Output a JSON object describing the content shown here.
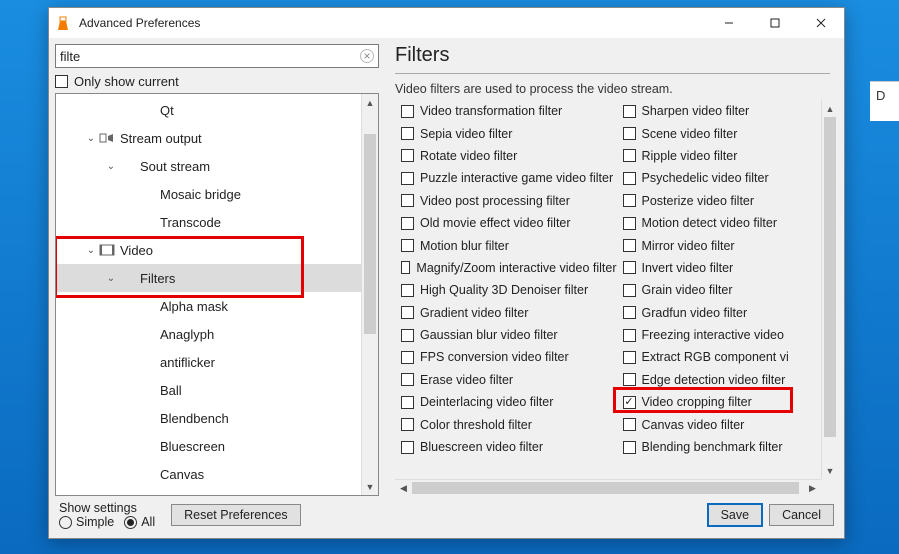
{
  "window": {
    "title": "Advanced Preferences"
  },
  "search": {
    "value": "filte"
  },
  "only_current_label": "Only show current",
  "tree": {
    "items": [
      {
        "label": "Qt",
        "indent": 3,
        "chev": "",
        "icon": ""
      },
      {
        "label": "Stream output",
        "indent": 1,
        "chev": "⌄",
        "icon": "stream"
      },
      {
        "label": "Sout stream",
        "indent": 2,
        "chev": "⌄",
        "icon": ""
      },
      {
        "label": "Mosaic bridge",
        "indent": 3,
        "chev": "",
        "icon": ""
      },
      {
        "label": "Transcode",
        "indent": 3,
        "chev": "",
        "icon": ""
      },
      {
        "label": "Video",
        "indent": 1,
        "chev": "⌄",
        "icon": "video"
      },
      {
        "label": "Filters",
        "indent": 2,
        "chev": "⌄",
        "icon": "",
        "selected": true
      },
      {
        "label": "Alpha mask",
        "indent": 3,
        "chev": "",
        "icon": ""
      },
      {
        "label": "Anaglyph",
        "indent": 3,
        "chev": "",
        "icon": ""
      },
      {
        "label": "antiflicker",
        "indent": 3,
        "chev": "",
        "icon": ""
      },
      {
        "label": "Ball",
        "indent": 3,
        "chev": "",
        "icon": ""
      },
      {
        "label": "Blendbench",
        "indent": 3,
        "chev": "",
        "icon": ""
      },
      {
        "label": "Bluescreen",
        "indent": 3,
        "chev": "",
        "icon": ""
      },
      {
        "label": "Canvas",
        "indent": 3,
        "chev": "",
        "icon": ""
      }
    ]
  },
  "panel": {
    "title": "Filters",
    "desc": "Video filters are used to process the video stream.",
    "left": [
      "Video transformation filter",
      "Sepia video filter",
      "Rotate video filter",
      "Puzzle interactive game video filter",
      "Video post processing filter",
      "Old movie effect video filter",
      "Motion blur filter",
      "Magnify/Zoom interactive video filter",
      "High Quality 3D Denoiser filter",
      "Gradient video filter",
      "Gaussian blur video filter",
      "FPS conversion video filter",
      "Erase video filter",
      "Deinterlacing video filter",
      "Color threshold filter",
      "Bluescreen video filter"
    ],
    "right": [
      {
        "label": "Sharpen video filter",
        "checked": false
      },
      {
        "label": "Scene video filter",
        "checked": false
      },
      {
        "label": "Ripple video filter",
        "checked": false
      },
      {
        "label": "Psychedelic video filter",
        "checked": false
      },
      {
        "label": "Posterize video filter",
        "checked": false
      },
      {
        "label": "Motion detect video filter",
        "checked": false
      },
      {
        "label": "Mirror video filter",
        "checked": false
      },
      {
        "label": "Invert video filter",
        "checked": false
      },
      {
        "label": "Grain video filter",
        "checked": false
      },
      {
        "label": "Gradfun video filter",
        "checked": false
      },
      {
        "label": "Freezing interactive video",
        "checked": false
      },
      {
        "label": "Extract RGB component vi",
        "checked": false
      },
      {
        "label": "Edge detection video filter",
        "checked": false
      },
      {
        "label": "Video cropping filter",
        "checked": true
      },
      {
        "label": "Canvas video filter",
        "checked": false
      },
      {
        "label": "Blending benchmark filter",
        "checked": false
      }
    ]
  },
  "footer": {
    "show_settings": "Show settings",
    "simple": "Simple",
    "all": "All",
    "reset": "Reset Preferences",
    "save": "Save",
    "cancel": "Cancel"
  },
  "desktop_extra": "D"
}
